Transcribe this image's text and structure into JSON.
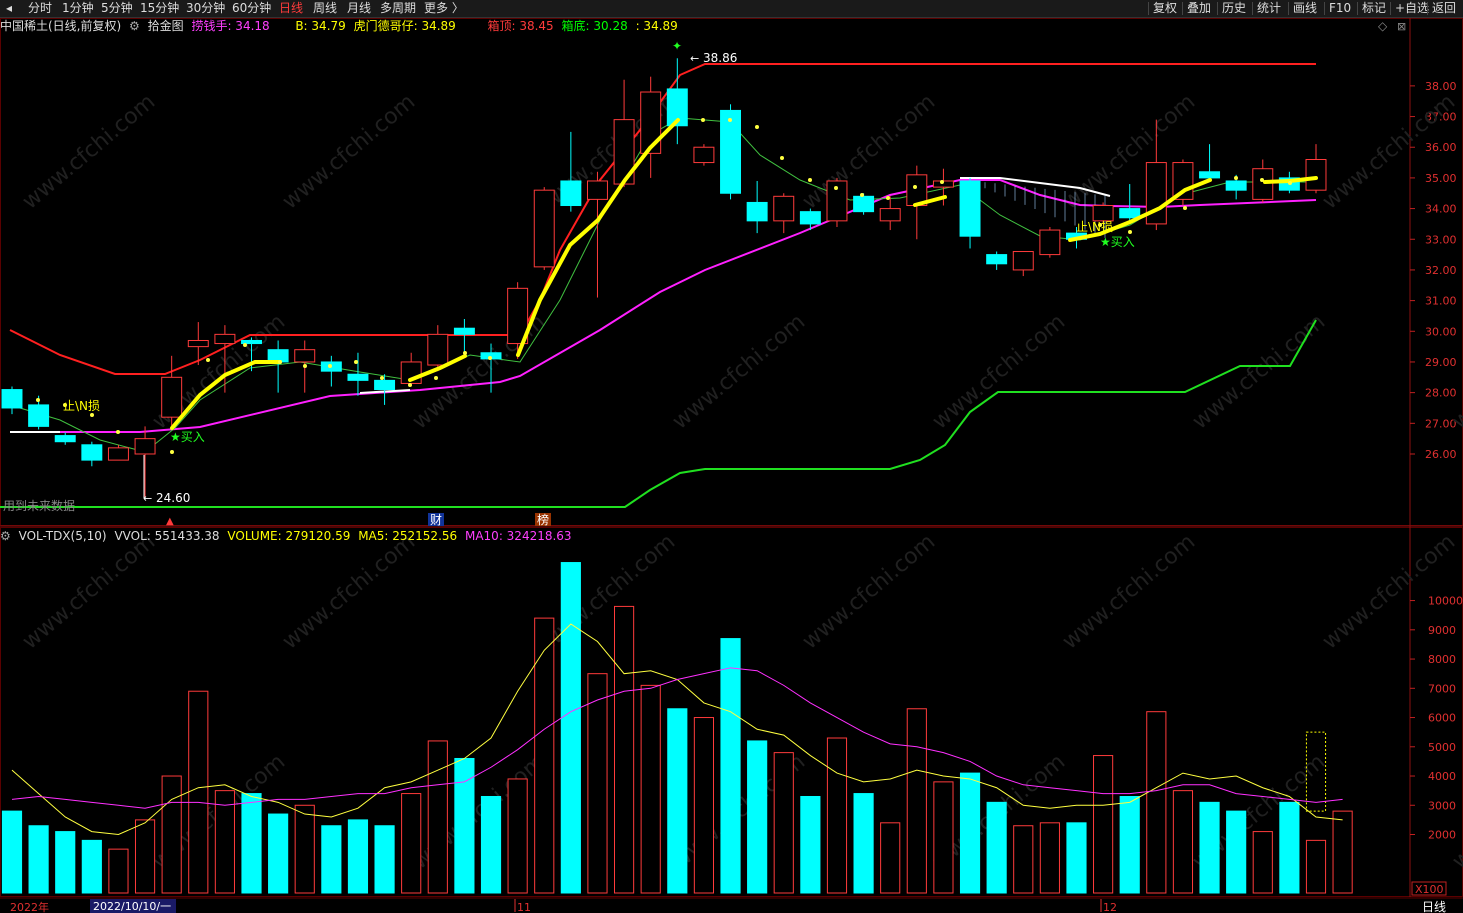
{
  "toolbar": {
    "periods": [
      "分时",
      "1分钟",
      "5分钟",
      "15分钟",
      "30分钟",
      "60分钟",
      "日线",
      "周线",
      "月线",
      "多周期",
      "更多 〉"
    ],
    "active_period": "日线",
    "right_items": [
      "复权",
      "叠加",
      "历史",
      "统计",
      "画线",
      "F10",
      "标记",
      "+自选",
      "返回"
    ]
  },
  "info": {
    "stock": "中国稀土(日线,前复权)",
    "indicator": "拾金图",
    "catch_label": "捞钱手: 34.18",
    "b_label": "B: 34.79",
    "hu_label": "虎门德哥仔: 34.89",
    "top_label": "箱顶: 38.45",
    "bottom_label": "箱底: 30.28",
    "bottom_val": ": 34.89"
  },
  "main_axis": {
    "ticks": [
      "38.00",
      "37.00",
      "36.00",
      "35.00",
      "34.00",
      "33.00",
      "32.00",
      "31.00",
      "30.00",
      "29.00",
      "28.00",
      "27.00",
      "26.00"
    ]
  },
  "annotations": {
    "high": "38.86",
    "low": "24.60",
    "buy1": "★买入",
    "buy2": "★买入",
    "stop1": "止\\N损",
    "stop2": "止\\N损",
    "future_note": "用到未来数据",
    "cai": "财",
    "bang": "榜",
    "arrow_marker": "▲"
  },
  "volume": {
    "indicator": "VOL-TDX(5,10)",
    "vvol": "VVOL: 551433.38",
    "volume": "VOLUME: 279120.59",
    "ma5": "MA5: 252152.56",
    "ma10": "MA10: 324218.63",
    "ticks": [
      "10000",
      "9000",
      "8000",
      "7000",
      "6000",
      "5000",
      "4000",
      "3000",
      "2000"
    ],
    "unit": "X100"
  },
  "dates": {
    "year": "2022年",
    "cursor_date": "2022/10/10/一",
    "m11": "11",
    "m12": "12",
    "period_label": "日线"
  },
  "colors": {
    "up": "#ff3b3b",
    "down": "#00ffff",
    "yellow": "#ffff00",
    "magenta": "#ff00ff",
    "green": "#00ff00",
    "red_line": "#ff2020"
  },
  "chart_data": {
    "type": "candlestick",
    "ylim": [
      24.5,
      39.3
    ],
    "candles": [
      {
        "o": 27.5,
        "c": 28.1,
        "h": 28.2,
        "l": 27.3,
        "dir": "down"
      },
      {
        "o": 27.6,
        "c": 26.9,
        "h": 27.9,
        "l": 26.8,
        "dir": "down"
      },
      {
        "o": 26.6,
        "c": 26.4,
        "h": 26.7,
        "l": 26.3,
        "dir": "down"
      },
      {
        "o": 26.3,
        "c": 25.8,
        "h": 26.4,
        "l": 25.6,
        "dir": "down"
      },
      {
        "o": 25.8,
        "c": 26.2,
        "h": 26.3,
        "l": 25.8,
        "dir": "up"
      },
      {
        "o": 26.0,
        "c": 26.5,
        "h": 26.9,
        "l": 24.6,
        "dir": "up"
      },
      {
        "o": 27.2,
        "c": 28.5,
        "h": 29.2,
        "l": 26.8,
        "dir": "up"
      },
      {
        "o": 29.5,
        "c": 29.7,
        "h": 30.3,
        "l": 28.9,
        "dir": "up"
      },
      {
        "o": 29.6,
        "c": 29.9,
        "h": 30.2,
        "l": 28.0,
        "dir": "up"
      },
      {
        "o": 29.7,
        "c": 29.6,
        "h": 29.8,
        "l": 28.7,
        "dir": "down"
      },
      {
        "o": 29.4,
        "c": 29.0,
        "h": 29.7,
        "l": 28.0,
        "dir": "down"
      },
      {
        "o": 29.4,
        "c": 29.0,
        "h": 29.7,
        "l": 28.0,
        "dir": "up"
      },
      {
        "o": 29.0,
        "c": 28.7,
        "h": 29.2,
        "l": 28.2,
        "dir": "down"
      },
      {
        "o": 28.6,
        "c": 28.4,
        "h": 29.3,
        "l": 27.9,
        "dir": "down"
      },
      {
        "o": 28.4,
        "c": 28.1,
        "h": 28.6,
        "l": 27.6,
        "dir": "down"
      },
      {
        "o": 28.3,
        "c": 29.0,
        "h": 29.3,
        "l": 28.2,
        "dir": "up"
      },
      {
        "o": 28.9,
        "c": 29.9,
        "h": 30.2,
        "l": 28.7,
        "dir": "up"
      },
      {
        "o": 30.1,
        "c": 29.9,
        "h": 30.4,
        "l": 29.3,
        "dir": "down"
      },
      {
        "o": 29.3,
        "c": 29.1,
        "h": 29.6,
        "l": 28.0,
        "dir": "down"
      },
      {
        "o": 29.6,
        "c": 31.4,
        "h": 31.6,
        "l": 29.1,
        "dir": "up"
      },
      {
        "o": 32.1,
        "c": 34.6,
        "h": 34.7,
        "l": 32.0,
        "dir": "up"
      },
      {
        "o": 34.9,
        "c": 34.1,
        "h": 36.5,
        "l": 33.9,
        "dir": "down"
      },
      {
        "o": 34.3,
        "c": 34.9,
        "h": 35.2,
        "l": 31.1,
        "dir": "up"
      },
      {
        "o": 34.8,
        "c": 36.9,
        "h": 38.2,
        "l": 34.7,
        "dir": "up"
      },
      {
        "o": 35.8,
        "c": 37.8,
        "h": 38.3,
        "l": 35.0,
        "dir": "up"
      },
      {
        "o": 37.9,
        "c": 36.7,
        "h": 38.9,
        "l": 36.1,
        "dir": "down"
      },
      {
        "o": 35.5,
        "c": 36.0,
        "h": 36.1,
        "l": 35.4,
        "dir": "up"
      },
      {
        "o": 37.2,
        "c": 34.5,
        "h": 37.4,
        "l": 34.3,
        "dir": "down"
      },
      {
        "o": 34.2,
        "c": 33.6,
        "h": 34.9,
        "l": 33.2,
        "dir": "down"
      },
      {
        "o": 33.6,
        "c": 34.4,
        "h": 34.5,
        "l": 33.2,
        "dir": "up"
      },
      {
        "o": 33.9,
        "c": 33.5,
        "h": 34.0,
        "l": 33.3,
        "dir": "down"
      },
      {
        "o": 33.6,
        "c": 34.9,
        "h": 35.0,
        "l": 33.4,
        "dir": "up"
      },
      {
        "o": 34.4,
        "c": 33.9,
        "h": 34.5,
        "l": 33.8,
        "dir": "down"
      },
      {
        "o": 33.6,
        "c": 34.0,
        "h": 34.4,
        "l": 33.3,
        "dir": "up"
      },
      {
        "o": 34.1,
        "c": 35.1,
        "h": 35.4,
        "l": 33.0,
        "dir": "up"
      },
      {
        "o": 34.7,
        "c": 34.9,
        "h": 35.3,
        "l": 34.1,
        "dir": "up"
      },
      {
        "o": 34.9,
        "c": 33.1,
        "h": 35.0,
        "l": 32.7,
        "dir": "down"
      },
      {
        "o": 32.5,
        "c": 32.2,
        "h": 32.6,
        "l": 32.0,
        "dir": "down"
      },
      {
        "o": 32.0,
        "c": 32.6,
        "h": 32.6,
        "l": 31.8,
        "dir": "up"
      },
      {
        "o": 32.5,
        "c": 33.3,
        "h": 33.4,
        "l": 32.4,
        "dir": "up"
      },
      {
        "o": 33.2,
        "c": 33.0,
        "h": 33.4,
        "l": 32.7,
        "dir": "down"
      },
      {
        "o": 33.6,
        "c": 34.1,
        "h": 34.2,
        "l": 33.5,
        "dir": "up"
      },
      {
        "o": 34.0,
        "c": 33.7,
        "h": 34.8,
        "l": 33.6,
        "dir": "down"
      },
      {
        "o": 33.5,
        "c": 35.5,
        "h": 36.9,
        "l": 33.3,
        "dir": "up"
      },
      {
        "o": 34.3,
        "c": 35.5,
        "h": 35.6,
        "l": 34.1,
        "dir": "up"
      },
      {
        "o": 35.2,
        "c": 35.0,
        "h": 36.1,
        "l": 34.9,
        "dir": "down"
      },
      {
        "o": 34.9,
        "c": 34.6,
        "h": 35.1,
        "l": 34.3,
        "dir": "down"
      },
      {
        "o": 34.3,
        "c": 35.3,
        "h": 35.6,
        "l": 34.2,
        "dir": "up"
      },
      {
        "o": 35.0,
        "c": 34.6,
        "h": 35.2,
        "l": 34.5,
        "dir": "down"
      },
      {
        "o": 34.6,
        "c": 35.6,
        "h": 36.1,
        "l": 34.5,
        "dir": "up"
      }
    ],
    "volumes": [
      2800,
      2300,
      2100,
      1800,
      1500,
      2500,
      4000,
      6900,
      3500,
      3400,
      2700,
      3000,
      2300,
      2500,
      2300,
      3400,
      5200,
      4600,
      3300,
      3900,
      9400,
      11300,
      7500,
      9800,
      7100,
      6300,
      6000,
      8700,
      5200,
      4800,
      3300,
      5300,
      3400,
      2400,
      6300,
      3800,
      4100,
      3100,
      2300,
      2400,
      2400,
      4700,
      3300,
      6200,
      3500,
      3100,
      2800,
      2100,
      3100,
      1800,
      2800
    ],
    "ma5": [
      4200,
      3400,
      2600,
      2100,
      2000,
      2400,
      3200,
      3600,
      3700,
      3300,
      3100,
      2700,
      2600,
      2900,
      3600,
      3800,
      4200,
      4600,
      5300,
      6900,
      8300,
      9200,
      8600,
      7500,
      7600,
      7300,
      6500,
      6200,
      5600,
      5400,
      4700,
      4100,
      3800,
      3900,
      4200,
      4000,
      3900,
      3600,
      3000,
      2900,
      3000,
      3000,
      3100,
      3600,
      4100,
      3900,
      4000,
      3600,
      3300,
      2600,
      2500
    ],
    "ma10": [
      3200,
      3300,
      3200,
      3100,
      3000,
      2900,
      3100,
      3100,
      3000,
      3100,
      3200,
      3200,
      3300,
      3400,
      3400,
      3600,
      3700,
      3800,
      4300,
      4900,
      5600,
      6200,
      6600,
      6900,
      7000,
      7300,
      7500,
      7700,
      7600,
      7100,
      6500,
      6000,
      5500,
      5100,
      5000,
      4800,
      4500,
      4000,
      3700,
      3600,
      3500,
      3400,
      3400,
      3500,
      3700,
      3700,
      3400,
      3300,
      3200,
      3100,
      3200
    ]
  }
}
